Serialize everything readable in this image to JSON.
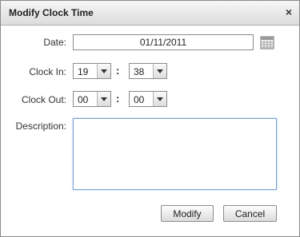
{
  "dialog": {
    "title": "Modify Clock Time",
    "close_glyph": "×"
  },
  "form": {
    "date_label": "Date:",
    "date_value": "01/11/2011",
    "calendar_icon": "calendar-icon",
    "clock_in_label": "Clock In:",
    "clock_in_hour": "19",
    "clock_in_minute": "38",
    "clock_out_label": "Clock Out:",
    "clock_out_hour": "00",
    "clock_out_minute": "00",
    "time_separator": ":",
    "description_label": "Description:",
    "description_value": ""
  },
  "buttons": {
    "modify": "Modify",
    "cancel": "Cancel"
  },
  "colors": {
    "focus_border": "#7aa3cf"
  }
}
